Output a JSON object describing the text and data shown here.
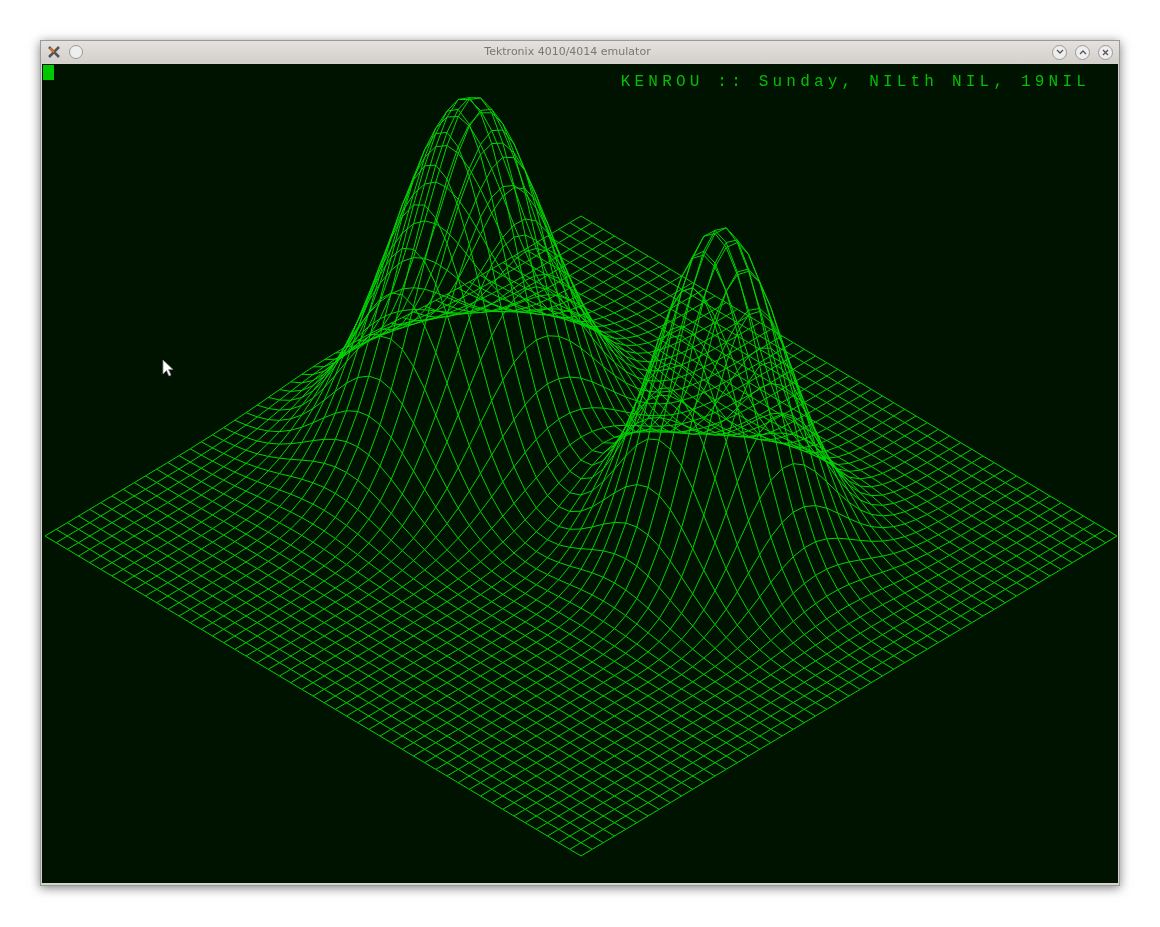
{
  "window": {
    "title": "Tektronix 4010/4014 emulator"
  },
  "terminal": {
    "header": "KENROU :: Sunday, NILth NIL, 19NIL"
  }
}
